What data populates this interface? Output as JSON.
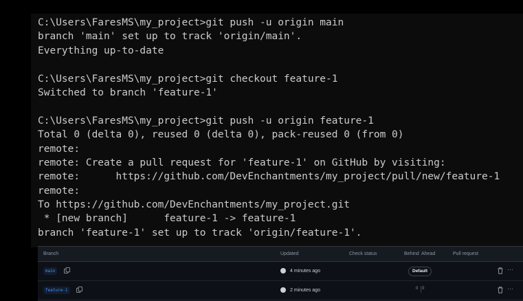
{
  "terminal": {
    "lines": [
      "C:\\Users\\FaresMS\\my_project>git push -u origin main",
      "branch 'main' set up to track 'origin/main'.",
      "Everything up-to-date",
      "",
      "C:\\Users\\FaresMS\\my_project>git checkout feature-1",
      "Switched to branch 'feature-1'",
      "",
      "C:\\Users\\FaresMS\\my_project>git push -u origin feature-1",
      "Total 0 (delta 0), reused 0 (delta 0), pack-reused 0 (from 0)",
      "remote:",
      "remote: Create a pull request for 'feature-1' on GitHub by visiting:",
      "remote:      https://github.com/DevEnchantments/my_project/pull/new/feature-1",
      "remote:",
      "To https://github.com/DevEnchantments/my_project.git",
      " * [new branch]      feature-1 -> feature-1",
      "branch 'feature-1' set up to track 'origin/feature-1'."
    ]
  },
  "branches_table": {
    "headers": {
      "branch": "Branch",
      "updated": "Updated",
      "check_status": "Check status",
      "behind": "Behind",
      "ahead": "Ahead",
      "pull_request": "Pull request"
    },
    "rows": [
      {
        "name": "main",
        "updated": "4 minutes ago",
        "badge": "Default",
        "behind": "",
        "ahead": ""
      },
      {
        "name": "feature-1",
        "updated": "2 minutes ago",
        "badge": "",
        "behind": "0",
        "ahead": "0"
      }
    ]
  },
  "colors": {
    "terminal_bg": "#0c0c0c",
    "terminal_text": "#cccccc",
    "panel_bg": "#0d1117",
    "branch_link": "#4493f8"
  },
  "icons": [
    "copy-icon",
    "trash-icon",
    "kebab-menu-icon",
    "avatar"
  ]
}
